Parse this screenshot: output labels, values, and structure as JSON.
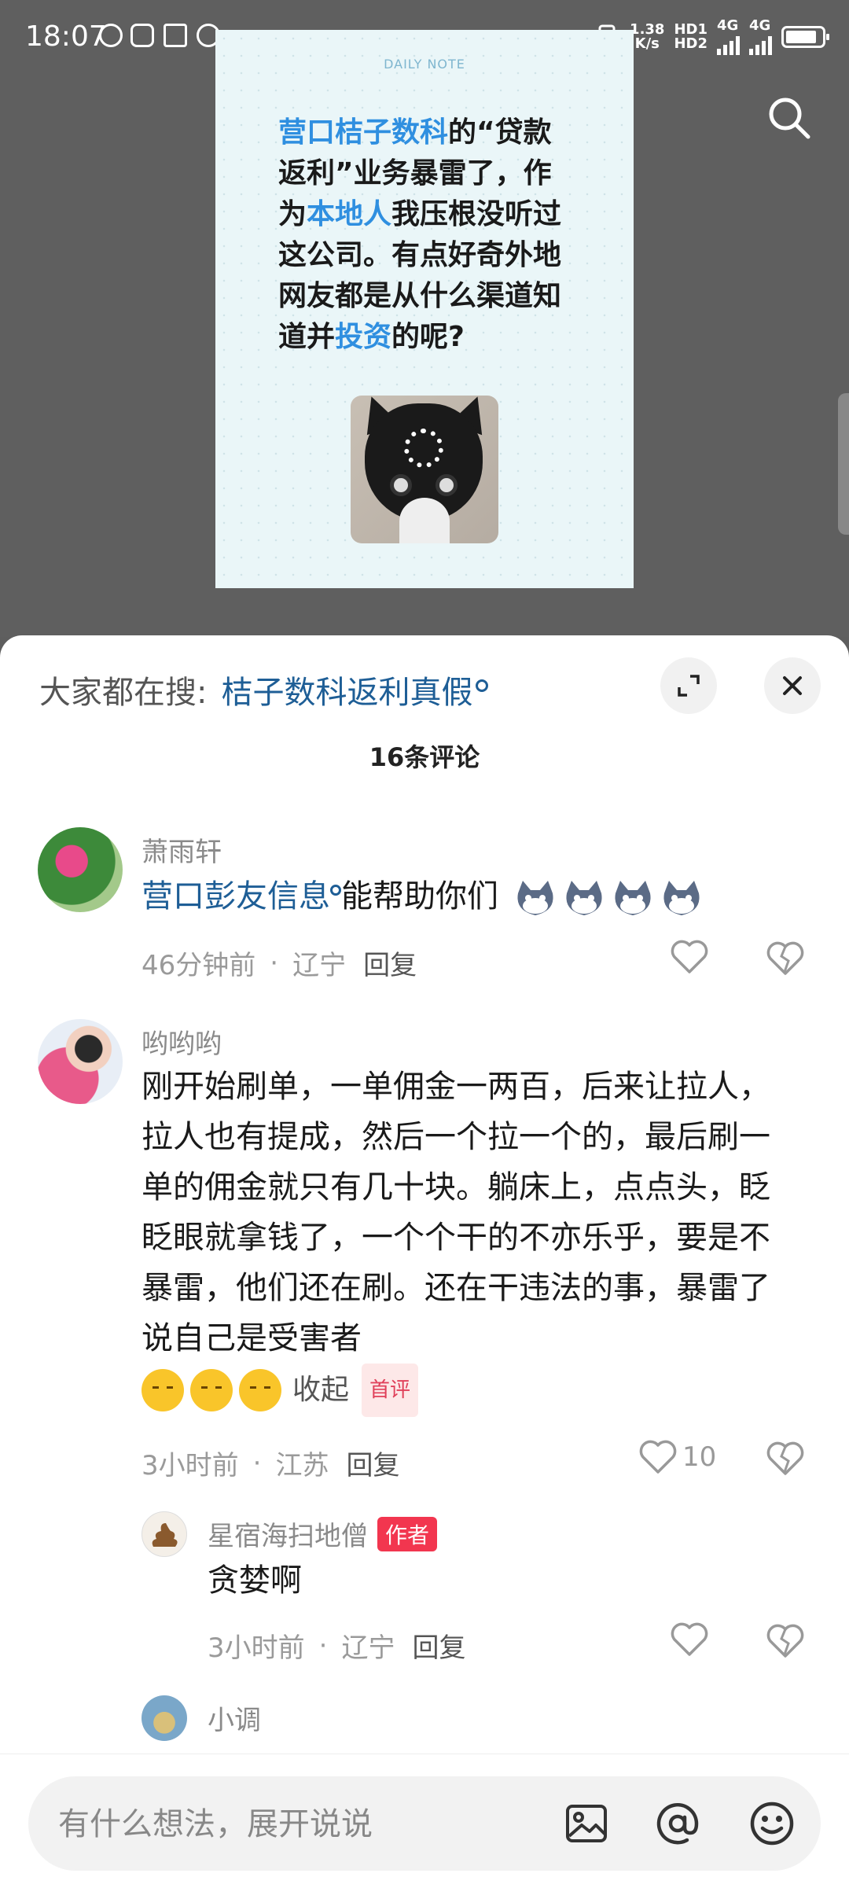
{
  "status_bar": {
    "time": "18:07",
    "network_speed": "1.38",
    "network_unit": "K/s",
    "hd1": "HD1",
    "hd2": "HD2",
    "net1": "4G",
    "net2": "4G"
  },
  "post": {
    "header": "DAILY NOTE",
    "text_parts": [
      {
        "text": "营口桔子数科",
        "highlight": true
      },
      {
        "text": "的“贷款返利”业务暴雷了，作为",
        "highlight": false
      },
      {
        "text": "本地人",
        "highlight": true
      },
      {
        "text": "我压根没听过这公司。有点好奇外地网友都是从什么渠道知道并",
        "highlight": false
      },
      {
        "text": "投资",
        "highlight": true
      },
      {
        "text": "的呢?",
        "highlight": false
      }
    ]
  },
  "sheet": {
    "hot_search_prefix": "大家都在搜:",
    "hot_search_link": "桔子数科返利真假",
    "comments_title": "16条评论"
  },
  "comments": [
    {
      "user": "萧雨轩",
      "link": "营口彭友信息",
      "text": "能帮助你们",
      "time": "46分钟前",
      "location": "辽宁",
      "reply": "回复"
    },
    {
      "user": "哟哟哟",
      "text": "刚开始刷单，一单佣金一两百，后来让拉人，拉人也有提成，然后一个拉一个的，最后刷一单的佣金就只有几十块。躺床上，点点头，眨眨眼就拿钱了，一个个干的不亦乐乎，要是不暴雷，他们还在刷。还在干违法的事，暴雷了说自己是受害者",
      "collapse": "收起",
      "badge": "首评",
      "time": "3小时前",
      "location": "江苏",
      "reply": "回复",
      "likes": "10"
    },
    {
      "user": "星宿海扫地僧",
      "badge": "作者",
      "text": "贪婪啊",
      "time": "3小时前",
      "location": "辽宁",
      "reply": "回复"
    },
    {
      "user": "小调"
    }
  ],
  "input": {
    "placeholder": "有什么想法，展开说说"
  }
}
